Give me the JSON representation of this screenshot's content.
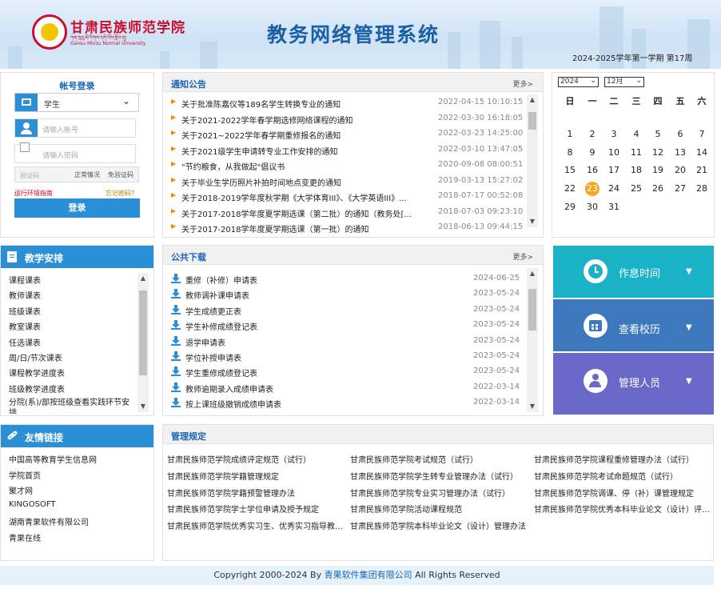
{
  "header": {
    "school_name": "甘肃民族师范学院",
    "school_name_tibetan": "ཀན་སུའུ་མི་རིགས་དགེ་འོས་སློབ་གྲྭ།",
    "school_name_en": "Gansu Minzu Normal University",
    "system_title": "教务网络管理系统",
    "term_info": "2024-2025学年第一学期 第17周"
  },
  "login": {
    "title": "帐号登录",
    "role_value": "学生",
    "account_placeholder": "请输入帐号",
    "password_placeholder": "请输入密码",
    "captcha_placeholder": "验证码",
    "captcha_hint_1": "正常情况",
    "captcha_hint_2": "免验证码",
    "env_guide": "运行环境指南",
    "forgot_password": "忘记密码?",
    "login_button": "登录"
  },
  "notices": {
    "title": "通知公告",
    "more": "更多>",
    "items": [
      {
        "title": "关于批准陈嘉仪等189名学生转换专业的通知",
        "date": "2022-04-15 10:10:15"
      },
      {
        "title": "关于2021-2022学年春学期选修网络课程的通知",
        "date": "2022-03-30 16:18:05"
      },
      {
        "title": "关于2021~2022学年春学期重修报名的通知",
        "date": "2022-03-23 14:25:00"
      },
      {
        "title": "关于2021级学生申请转专业工作安排的通知",
        "date": "2022-03-10 13:47:05"
      },
      {
        "title": "\"节约粮食，从我做起\"倡议书",
        "date": "2020-09-08 08:00:51"
      },
      {
        "title": "关于毕业生学历照片补拍时间地点变更的通知",
        "date": "2019-03-13 15:27:02"
      },
      {
        "title": "关于2018-2019学年度秋学期《大学体育III》、《大学英语III》...",
        "date": "2018-07-17 00:52:08"
      },
      {
        "title": "关于2017-2018学年度夏学期选课（第二批）的通知（教务处[...",
        "date": "2018-07-03 09:23:10"
      },
      {
        "title": "关于2017-2018学年度夏学期选课（第一批）的通知",
        "date": "2018-06-13 09:44:15"
      }
    ]
  },
  "calendar": {
    "year": "2024",
    "month": "12月",
    "weekdays": [
      "日",
      "一",
      "二",
      "三",
      "四",
      "五",
      "六"
    ],
    "rows": [
      [
        "1",
        "2",
        "3",
        "4",
        "5",
        "6",
        "7"
      ],
      [
        "8",
        "9",
        "10",
        "11",
        "12",
        "13",
        "14"
      ],
      [
        "15",
        "16",
        "17",
        "18",
        "19",
        "20",
        "21"
      ],
      [
        "22",
        "23",
        "24",
        "25",
        "26",
        "27",
        "28"
      ],
      [
        "29",
        "30",
        "31",
        "",
        "",
        "",
        ""
      ]
    ],
    "today": "23"
  },
  "teaching": {
    "title": "教学安排",
    "items": [
      "课程课表",
      "教师课表",
      "班级课表",
      "教室课表",
      "任选课表",
      "周/日/节次课表",
      "课程教学进度表",
      "班级教学进度表",
      "分院(系)/部按班级查看实践环节安排"
    ]
  },
  "downloads": {
    "title": "公共下载",
    "more": "更多>",
    "items": [
      {
        "title": "重修（补修）申请表",
        "date": "2024-06-25"
      },
      {
        "title": "教师调补课申请表",
        "date": "2023-05-24"
      },
      {
        "title": "学生成绩更正表",
        "date": "2023-05-24"
      },
      {
        "title": "学生补修成绩登记表",
        "date": "2023-05-24"
      },
      {
        "title": "退学申请表",
        "date": "2023-05-24"
      },
      {
        "title": "学位补授申请表",
        "date": "2023-05-24"
      },
      {
        "title": "学生重修成绩登记表",
        "date": "2023-05-24"
      },
      {
        "title": "教师逾期录入成绩申请表",
        "date": "2022-03-14"
      },
      {
        "title": "按上课班级撤销成绩申请表",
        "date": "2022-03-14"
      }
    ]
  },
  "tiles": [
    {
      "label": "作息时间",
      "color": "#1ab2c6",
      "icon": "alarm-clock-icon"
    },
    {
      "label": "查看校历",
      "color": "#3d78bd",
      "icon": "calendar-grid-icon"
    },
    {
      "label": "管理人员",
      "color": "#6a68c8",
      "icon": "user-star-icon"
    }
  ],
  "links": {
    "title": "友情链接",
    "items": [
      "中国高等教育学生信息网",
      "学院首页",
      "聚才网",
      "KINGOSOFT",
      "湖南青果软件有限公司",
      "青果在线"
    ]
  },
  "regulations": {
    "title": "管理规定",
    "items": [
      "甘肃民族师范学院成绩评定规范（试行）",
      "甘肃民族师范学院考试规范（试行）",
      "甘肃民族师范学院课程重修管理办法（试行）",
      "甘肃民族师范学院学籍管理规定",
      "甘肃民族师范学院学生转专业管理办法（试行）",
      "甘肃民族师范学院考试命题规范（试行）",
      "甘肃民族师范学院学籍预警管理办法",
      "甘肃民族师范学院专业实习管理办法（试行）",
      "甘肃民族师范学院调课、停（补）课管理规定",
      "甘肃民族师范学院学士学位申请及授予规定",
      "甘肃民族师范学院活动课程规范",
      "甘肃民族师范学院优秀本科毕业论文（设计）评选办法",
      "甘肃民族师范学院优秀实习生、优秀实习指导教师评选办法",
      "甘肃民族师范学院本科毕业论文（设计）管理办法"
    ]
  },
  "footer": {
    "prefix": "Copyright 2000-2024 By ",
    "company": "青果软件集团有限公司",
    "suffix": " All Rights Reserved"
  }
}
